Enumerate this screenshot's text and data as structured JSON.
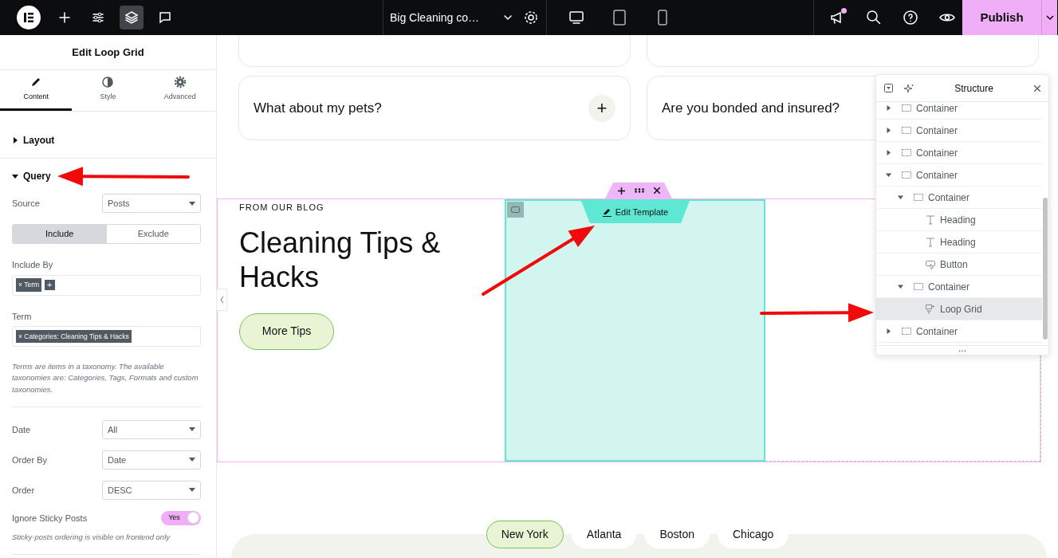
{
  "topbar": {
    "tools": [
      {
        "kind": "logo",
        "selected": false
      },
      {
        "kind": "add",
        "selected": false
      },
      {
        "kind": "settings",
        "selected": false
      },
      {
        "kind": "layers",
        "selected": true
      },
      {
        "kind": "comments",
        "selected": false
      }
    ],
    "document_title": "Big Cleaning co…",
    "devices": [
      {
        "kind": "desktop",
        "selected": true
      },
      {
        "kind": "tablet",
        "selected": false
      },
      {
        "kind": "mobile",
        "selected": false
      }
    ],
    "notification": true,
    "publish": "Publish"
  },
  "panel": {
    "title": "Edit Loop Grid",
    "tabs": [
      {
        "kind": "content",
        "label": "Content",
        "selected": true
      },
      {
        "kind": "style",
        "label": "Style",
        "selected": false
      },
      {
        "kind": "advanced",
        "label": "Advanced",
        "selected": false
      }
    ],
    "sections": [
      {
        "title": "Layout",
        "expanded": false
      },
      {
        "title": "Query",
        "expanded": true,
        "controls": [
          {
            "kind": "select",
            "label": "Source",
            "value": "Posts"
          },
          {
            "kind": "segmented",
            "options": [
              {
                "label": "Include",
                "selected": true
              },
              {
                "label": "Exclude",
                "selected": false
              }
            ]
          },
          {
            "kind": "tags",
            "label": "Include By",
            "tags": [
              "× Term"
            ],
            "add": "+"
          },
          {
            "kind": "tags",
            "label": "Term",
            "tags": [
              "× Categories: Cleaning Tips & Hacks"
            ]
          },
          {
            "kind": "note",
            "text": "Terms are items in a taxonomy. The available taxonomies are: Categories, Tags, Formats and custom taxonomies."
          },
          {
            "kind": "divider"
          },
          {
            "kind": "select",
            "label": "Date",
            "value": "All"
          },
          {
            "kind": "select",
            "label": "Order By",
            "value": "Date"
          },
          {
            "kind": "select",
            "label": "Order",
            "value": "DESC"
          },
          {
            "kind": "switch",
            "label": "Ignore Sticky Posts",
            "on": true,
            "text": "Yes"
          },
          {
            "kind": "note",
            "text": "Sticky-posts ordering is visible on frontend only"
          },
          {
            "kind": "divider"
          }
        ]
      }
    ]
  },
  "canvas": {
    "faq": [
      {
        "kind": "cut"
      },
      {
        "kind": "cut"
      },
      {
        "kind": "full",
        "question": "What about my pets?",
        "button": "+"
      },
      {
        "kind": "full",
        "question": "Are you bonded and insured?"
      }
    ],
    "blog": {
      "eyebrow": "FROM OUR BLOG",
      "heading": "Cleaning Tips & Hacks",
      "button": "More Tips"
    },
    "loop_template": {
      "label": "Edit Template"
    },
    "cities": [
      {
        "label": "New York",
        "selected": true
      },
      {
        "label": "Atlanta",
        "selected": false
      },
      {
        "label": "Boston",
        "selected": false
      },
      {
        "label": "Chicago",
        "selected": false
      }
    ]
  },
  "structure": {
    "title": "Structure",
    "items": [
      {
        "kind": "container",
        "label": "Container",
        "expanded": false,
        "selected": false
      },
      {
        "kind": "container",
        "label": "Container",
        "expanded": false,
        "selected": false
      },
      {
        "kind": "container",
        "label": "Container",
        "expanded": false,
        "selected": false
      },
      {
        "kind": "container",
        "label": "Container",
        "expanded": true,
        "selected": false,
        "children": [
          {
            "kind": "container",
            "label": "Container",
            "expanded": true,
            "selected": false,
            "children": [
              {
                "kind": "heading",
                "label": "Heading",
                "selected": false
              },
              {
                "kind": "heading",
                "label": "Heading",
                "selected": false
              },
              {
                "kind": "button",
                "label": "Button",
                "selected": false
              }
            ]
          },
          {
            "kind": "container",
            "label": "Container",
            "expanded": true,
            "selected": false,
            "children": [
              {
                "kind": "loop-grid",
                "label": "Loop Grid",
                "selected": true
              }
            ]
          }
        ]
      },
      {
        "kind": "container",
        "label": "Container",
        "expanded": false,
        "selected": false
      }
    ],
    "more": "..."
  }
}
